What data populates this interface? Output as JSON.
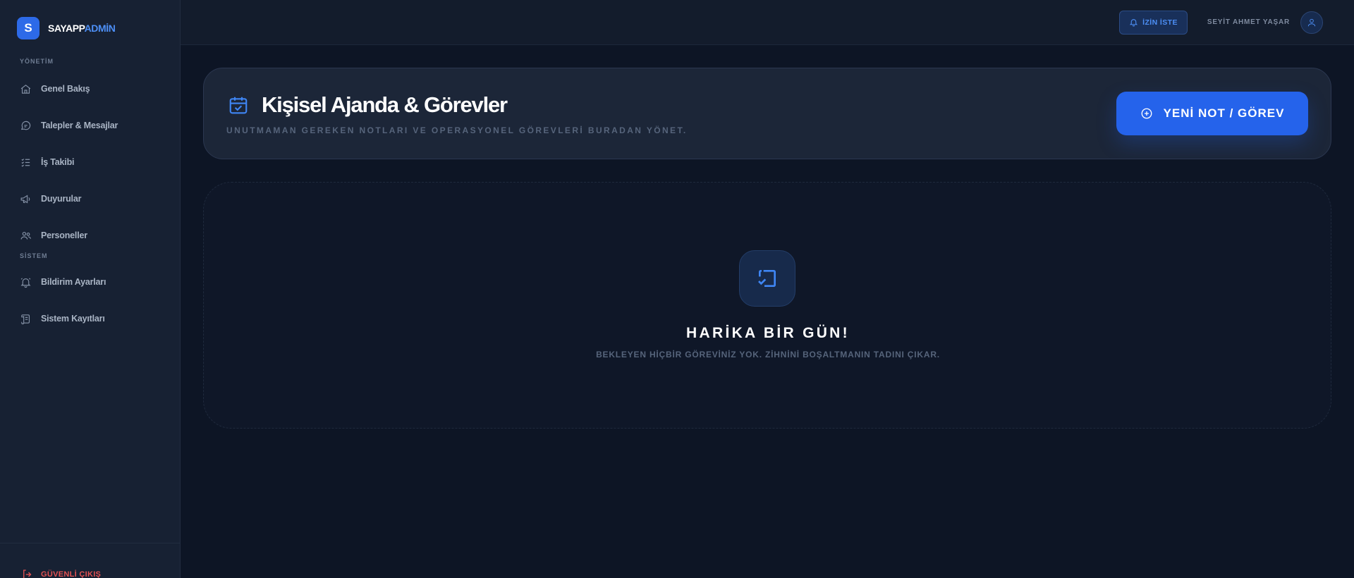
{
  "brand": {
    "logo_letter": "S",
    "name": "SAYAPP",
    "accent": "ADMİN"
  },
  "sidebar": {
    "sections": [
      {
        "label": "YÖNETİM",
        "items": [
          {
            "label": "Genel Bakış",
            "icon": "home-icon"
          },
          {
            "label": "Talepler & Mesajlar",
            "icon": "message-icon"
          },
          {
            "label": "İş Takibi",
            "icon": "checklist-icon"
          },
          {
            "label": "Duyurular",
            "icon": "megaphone-icon"
          },
          {
            "label": "Personeller",
            "icon": "users-icon"
          }
        ]
      },
      {
        "label": "SİSTEM",
        "items": [
          {
            "label": "Bildirim Ayarları",
            "icon": "bell-icon"
          },
          {
            "label": "Sistem Kayıtları",
            "icon": "scroll-icon"
          }
        ]
      }
    ],
    "logout_label": "GÜVENLİ ÇIKIŞ"
  },
  "topbar": {
    "leave_button": "İZİN İSTE",
    "user_name": "SEYİT AHMET YAŞAR"
  },
  "header": {
    "title": "Kişisel Ajanda & Görevler",
    "subtitle": "UNUTMAMAN GEREKEN NOTLARI VE OPERASYONEL GÖREVLERİ BURADAN YÖNET.",
    "new_button": "YENİ NOT / GÖREV"
  },
  "empty_state": {
    "title": "HARİKA BİR GÜN!",
    "text": "BEKLEYEN HİÇBİR GÖREVİNİZ YOK. ZİHNİNİ BOŞALTMANIN TADINI ÇIKAR."
  },
  "colors": {
    "background": "#0d1525",
    "sidebar": "#172133",
    "accent": "#2563eb",
    "accent_text": "#4d8ff6",
    "danger": "#e25252",
    "muted": "#56647b"
  }
}
